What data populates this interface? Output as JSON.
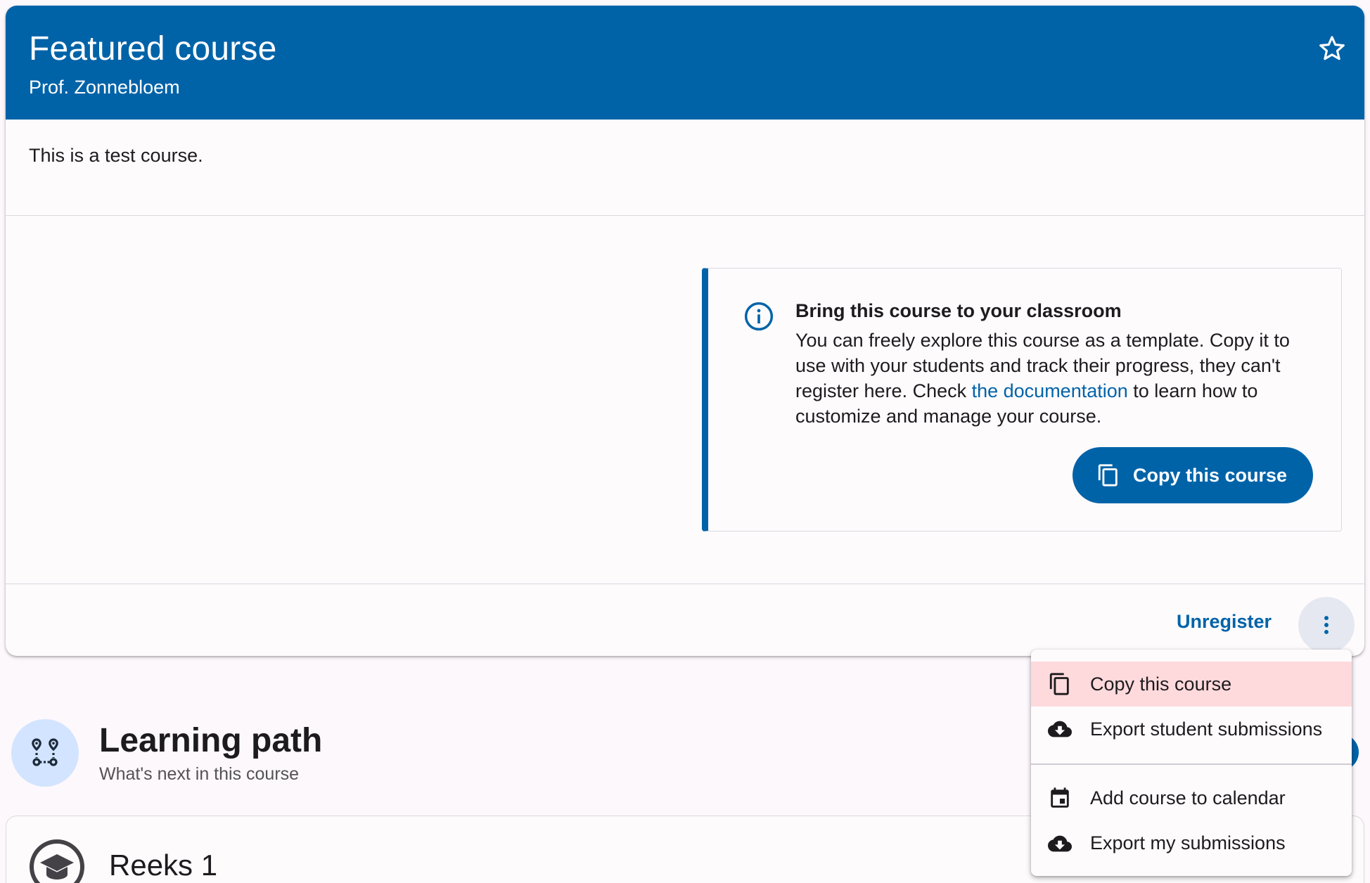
{
  "course": {
    "title": "Featured course",
    "teacher": "Prof. Zonnebloem",
    "description": "This is a test course."
  },
  "callout": {
    "title": "Bring this course to your classroom",
    "text_before": "You can freely explore this course as a template. Copy it to use with your students and track their progress, they can't register here. Check ",
    "link": "the documentation",
    "text_after": " to learn how to customize and manage your course.",
    "button": "Copy this course"
  },
  "actions": {
    "unregister": "Unregister"
  },
  "menu": {
    "items": [
      {
        "label": "Copy this course",
        "icon": "copy-icon"
      },
      {
        "label": "Export student submissions",
        "icon": "cloud-download-icon"
      },
      {
        "label": "Add course to calendar",
        "icon": "calendar-icon"
      },
      {
        "label": "Export my submissions",
        "icon": "cloud-download-icon"
      }
    ]
  },
  "learning_path": {
    "title": "Learning path",
    "subtitle": "What's next in this course"
  },
  "series": [
    {
      "title": "Reeks 1",
      "icon": "graduation-cap-icon"
    }
  ],
  "colors": {
    "primary": "#0063a8",
    "menu_highlight": "#ffdadd",
    "icon_bg": "#d2e4ff"
  }
}
